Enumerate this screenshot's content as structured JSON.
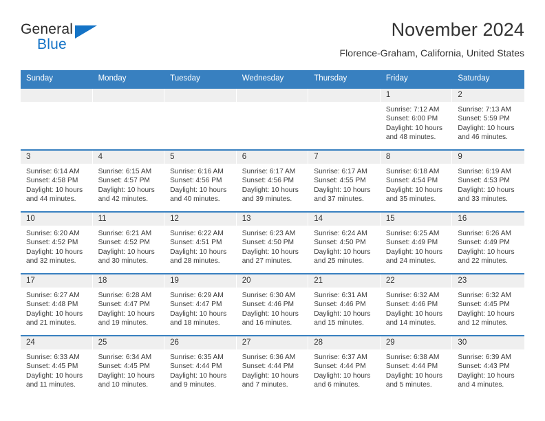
{
  "logo": {
    "word_one": "General",
    "word_two": "Blue",
    "triangle_color": "#1473c6"
  },
  "header": {
    "title": "November 2024",
    "subtitle": "Florence-Graham, California, United States"
  },
  "theme": {
    "header_blue": "#3880c0",
    "daynum_band": "#efefef",
    "text": "#333333"
  },
  "weekdays": [
    "Sunday",
    "Monday",
    "Tuesday",
    "Wednesday",
    "Thursday",
    "Friday",
    "Saturday"
  ],
  "weeks": [
    [
      {
        "day": "",
        "sunrise": "",
        "sunset": "",
        "daylight_1": "",
        "daylight_2": ""
      },
      {
        "day": "",
        "sunrise": "",
        "sunset": "",
        "daylight_1": "",
        "daylight_2": ""
      },
      {
        "day": "",
        "sunrise": "",
        "sunset": "",
        "daylight_1": "",
        "daylight_2": ""
      },
      {
        "day": "",
        "sunrise": "",
        "sunset": "",
        "daylight_1": "",
        "daylight_2": ""
      },
      {
        "day": "",
        "sunrise": "",
        "sunset": "",
        "daylight_1": "",
        "daylight_2": ""
      },
      {
        "day": "1",
        "sunrise": "Sunrise: 7:12 AM",
        "sunset": "Sunset: 6:00 PM",
        "daylight_1": "Daylight: 10 hours",
        "daylight_2": "and 48 minutes."
      },
      {
        "day": "2",
        "sunrise": "Sunrise: 7:13 AM",
        "sunset": "Sunset: 5:59 PM",
        "daylight_1": "Daylight: 10 hours",
        "daylight_2": "and 46 minutes."
      }
    ],
    [
      {
        "day": "3",
        "sunrise": "Sunrise: 6:14 AM",
        "sunset": "Sunset: 4:58 PM",
        "daylight_1": "Daylight: 10 hours",
        "daylight_2": "and 44 minutes."
      },
      {
        "day": "4",
        "sunrise": "Sunrise: 6:15 AM",
        "sunset": "Sunset: 4:57 PM",
        "daylight_1": "Daylight: 10 hours",
        "daylight_2": "and 42 minutes."
      },
      {
        "day": "5",
        "sunrise": "Sunrise: 6:16 AM",
        "sunset": "Sunset: 4:56 PM",
        "daylight_1": "Daylight: 10 hours",
        "daylight_2": "and 40 minutes."
      },
      {
        "day": "6",
        "sunrise": "Sunrise: 6:17 AM",
        "sunset": "Sunset: 4:56 PM",
        "daylight_1": "Daylight: 10 hours",
        "daylight_2": "and 39 minutes."
      },
      {
        "day": "7",
        "sunrise": "Sunrise: 6:17 AM",
        "sunset": "Sunset: 4:55 PM",
        "daylight_1": "Daylight: 10 hours",
        "daylight_2": "and 37 minutes."
      },
      {
        "day": "8",
        "sunrise": "Sunrise: 6:18 AM",
        "sunset": "Sunset: 4:54 PM",
        "daylight_1": "Daylight: 10 hours",
        "daylight_2": "and 35 minutes."
      },
      {
        "day": "9",
        "sunrise": "Sunrise: 6:19 AM",
        "sunset": "Sunset: 4:53 PM",
        "daylight_1": "Daylight: 10 hours",
        "daylight_2": "and 33 minutes."
      }
    ],
    [
      {
        "day": "10",
        "sunrise": "Sunrise: 6:20 AM",
        "sunset": "Sunset: 4:52 PM",
        "daylight_1": "Daylight: 10 hours",
        "daylight_2": "and 32 minutes."
      },
      {
        "day": "11",
        "sunrise": "Sunrise: 6:21 AM",
        "sunset": "Sunset: 4:52 PM",
        "daylight_1": "Daylight: 10 hours",
        "daylight_2": "and 30 minutes."
      },
      {
        "day": "12",
        "sunrise": "Sunrise: 6:22 AM",
        "sunset": "Sunset: 4:51 PM",
        "daylight_1": "Daylight: 10 hours",
        "daylight_2": "and 28 minutes."
      },
      {
        "day": "13",
        "sunrise": "Sunrise: 6:23 AM",
        "sunset": "Sunset: 4:50 PM",
        "daylight_1": "Daylight: 10 hours",
        "daylight_2": "and 27 minutes."
      },
      {
        "day": "14",
        "sunrise": "Sunrise: 6:24 AM",
        "sunset": "Sunset: 4:50 PM",
        "daylight_1": "Daylight: 10 hours",
        "daylight_2": "and 25 minutes."
      },
      {
        "day": "15",
        "sunrise": "Sunrise: 6:25 AM",
        "sunset": "Sunset: 4:49 PM",
        "daylight_1": "Daylight: 10 hours",
        "daylight_2": "and 24 minutes."
      },
      {
        "day": "16",
        "sunrise": "Sunrise: 6:26 AM",
        "sunset": "Sunset: 4:49 PM",
        "daylight_1": "Daylight: 10 hours",
        "daylight_2": "and 22 minutes."
      }
    ],
    [
      {
        "day": "17",
        "sunrise": "Sunrise: 6:27 AM",
        "sunset": "Sunset: 4:48 PM",
        "daylight_1": "Daylight: 10 hours",
        "daylight_2": "and 21 minutes."
      },
      {
        "day": "18",
        "sunrise": "Sunrise: 6:28 AM",
        "sunset": "Sunset: 4:47 PM",
        "daylight_1": "Daylight: 10 hours",
        "daylight_2": "and 19 minutes."
      },
      {
        "day": "19",
        "sunrise": "Sunrise: 6:29 AM",
        "sunset": "Sunset: 4:47 PM",
        "daylight_1": "Daylight: 10 hours",
        "daylight_2": "and 18 minutes."
      },
      {
        "day": "20",
        "sunrise": "Sunrise: 6:30 AM",
        "sunset": "Sunset: 4:46 PM",
        "daylight_1": "Daylight: 10 hours",
        "daylight_2": "and 16 minutes."
      },
      {
        "day": "21",
        "sunrise": "Sunrise: 6:31 AM",
        "sunset": "Sunset: 4:46 PM",
        "daylight_1": "Daylight: 10 hours",
        "daylight_2": "and 15 minutes."
      },
      {
        "day": "22",
        "sunrise": "Sunrise: 6:32 AM",
        "sunset": "Sunset: 4:46 PM",
        "daylight_1": "Daylight: 10 hours",
        "daylight_2": "and 14 minutes."
      },
      {
        "day": "23",
        "sunrise": "Sunrise: 6:32 AM",
        "sunset": "Sunset: 4:45 PM",
        "daylight_1": "Daylight: 10 hours",
        "daylight_2": "and 12 minutes."
      }
    ],
    [
      {
        "day": "24",
        "sunrise": "Sunrise: 6:33 AM",
        "sunset": "Sunset: 4:45 PM",
        "daylight_1": "Daylight: 10 hours",
        "daylight_2": "and 11 minutes."
      },
      {
        "day": "25",
        "sunrise": "Sunrise: 6:34 AM",
        "sunset": "Sunset: 4:45 PM",
        "daylight_1": "Daylight: 10 hours",
        "daylight_2": "and 10 minutes."
      },
      {
        "day": "26",
        "sunrise": "Sunrise: 6:35 AM",
        "sunset": "Sunset: 4:44 PM",
        "daylight_1": "Daylight: 10 hours",
        "daylight_2": "and 9 minutes."
      },
      {
        "day": "27",
        "sunrise": "Sunrise: 6:36 AM",
        "sunset": "Sunset: 4:44 PM",
        "daylight_1": "Daylight: 10 hours",
        "daylight_2": "and 7 minutes."
      },
      {
        "day": "28",
        "sunrise": "Sunrise: 6:37 AM",
        "sunset": "Sunset: 4:44 PM",
        "daylight_1": "Daylight: 10 hours",
        "daylight_2": "and 6 minutes."
      },
      {
        "day": "29",
        "sunrise": "Sunrise: 6:38 AM",
        "sunset": "Sunset: 4:44 PM",
        "daylight_1": "Daylight: 10 hours",
        "daylight_2": "and 5 minutes."
      },
      {
        "day": "30",
        "sunrise": "Sunrise: 6:39 AM",
        "sunset": "Sunset: 4:43 PM",
        "daylight_1": "Daylight: 10 hours",
        "daylight_2": "and 4 minutes."
      }
    ]
  ]
}
